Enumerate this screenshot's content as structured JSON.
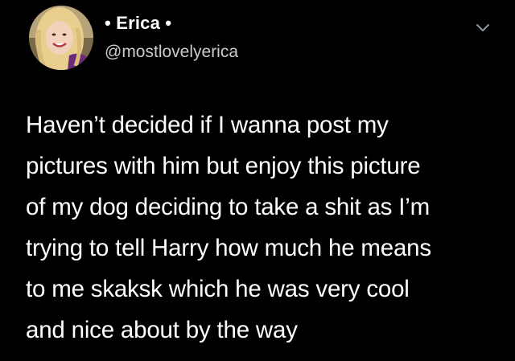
{
  "tweet": {
    "author": {
      "display_name": "• Erica •",
      "handle": "@mostlovelyerica",
      "avatar_icon": "profile-photo"
    },
    "menu_icon": "chevron-down-icon",
    "text": "Haven’t decided if I wanna post my\npictures with him but enjoy this picture\nof my dog deciding to take a shit as I’m\ntrying to tell Harry how much he means\nto me skaksk which he was very cool\nand nice about by the way"
  },
  "colors": {
    "background": "#000000",
    "text": "#ffffff",
    "handle": "#c8ccd0",
    "icon": "#8899a6"
  }
}
